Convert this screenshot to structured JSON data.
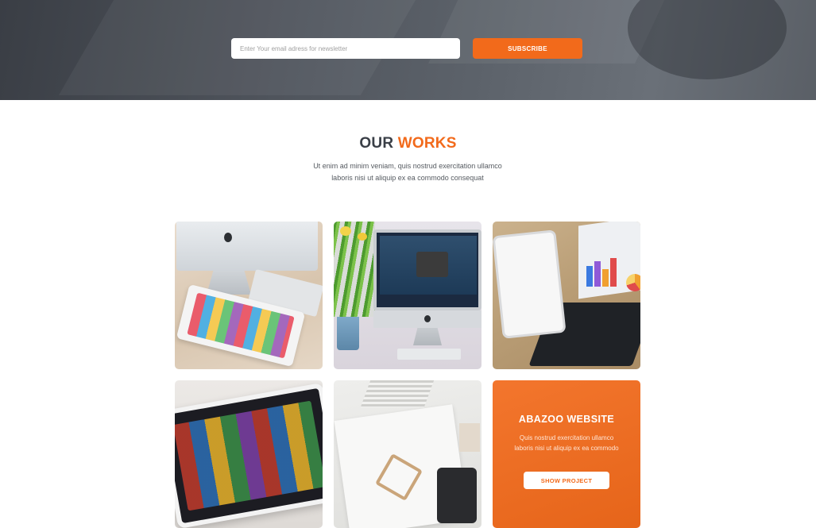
{
  "newsletter": {
    "email_placeholder": "Enter Your email adress for newsletter",
    "subscribe_label": "SUBSCRIBE"
  },
  "works": {
    "heading_part1": "OUR",
    "heading_part2": "WORKS",
    "description_line1": "Ut enim ad minim veniam, quis nostrud exercitation ullamco",
    "description_line2": "laboris nisi ut aliquip ex ea commodo consequat",
    "items": [
      {
        "image": "imac-with-tablet-photo"
      },
      {
        "image": "imac-with-flowers-photo"
      },
      {
        "image": "tablet-and-laptop-photo"
      },
      {
        "image": "tablet-games-photo"
      },
      {
        "image": "desk-stationery-photo"
      }
    ],
    "featured": {
      "title": "ABAZOO WEBSITE",
      "description_line1": "Quis nostrud exercitation ullamco",
      "description_line2": "laboris nisi ut aliquip ex ea commodo",
      "button_label": "SHOW PROJECT"
    }
  },
  "colors": {
    "accent": "#f26a1b",
    "heading_dark": "#3a3f47",
    "newsletter_bg": "#4f545c"
  }
}
